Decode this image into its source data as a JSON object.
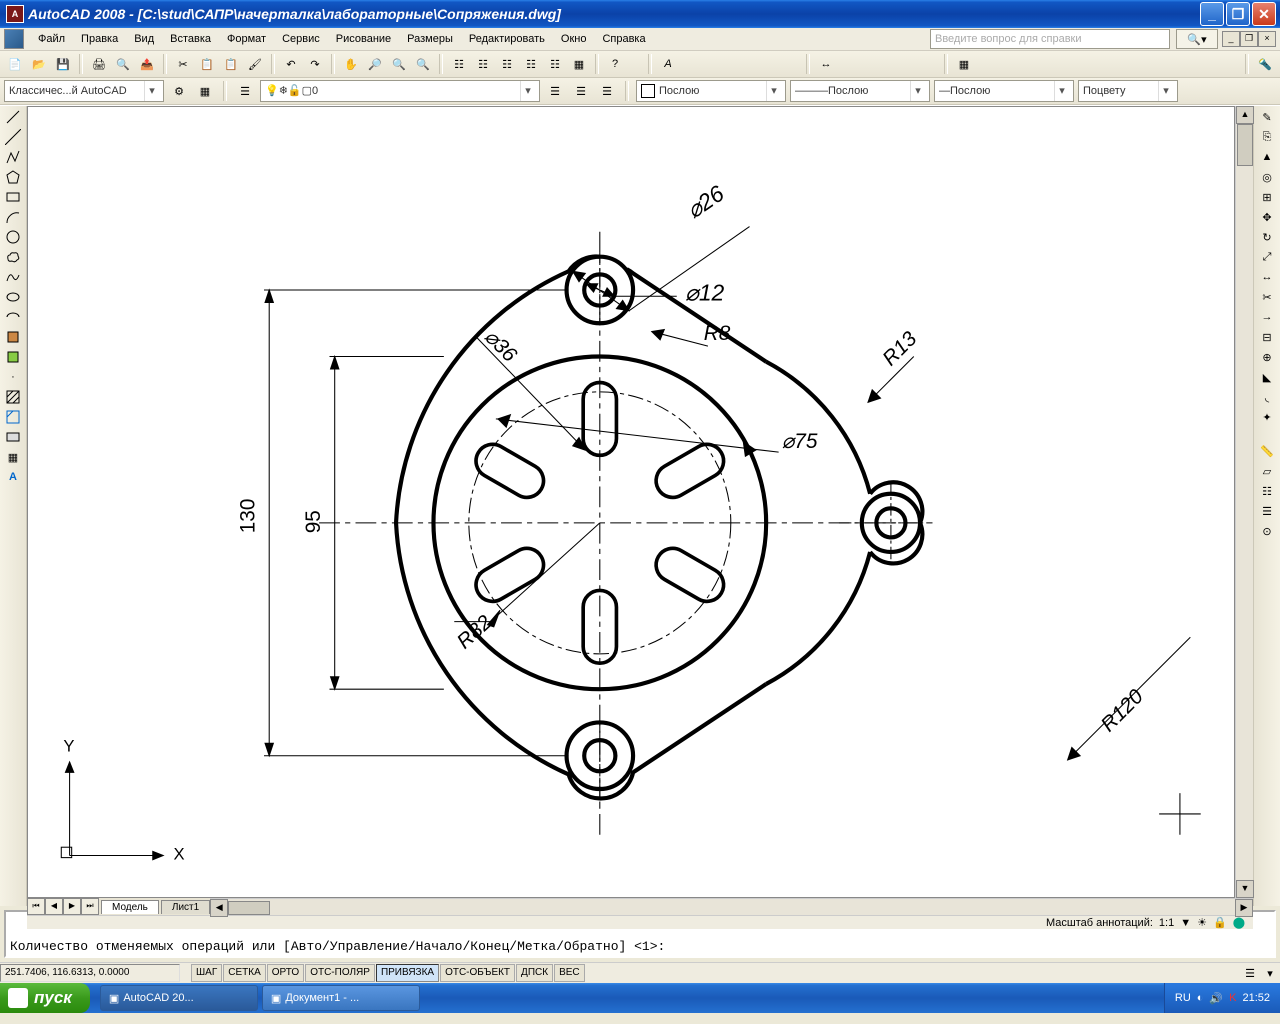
{
  "title": "AutoCAD 2008 - [C:\\stud\\САПР\\начерталка\\лабораторные\\Сопряжения.dwg]",
  "menu": [
    "Файл",
    "Правка",
    "Вид",
    "Вставка",
    "Формат",
    "Сервис",
    "Рисование",
    "Размеры",
    "Редактировать",
    "Окно",
    "Справка"
  ],
  "help_placeholder": "Введите вопрос для справки",
  "workspace_combo": "Классичес...й AutoCAD",
  "layer_combo": "0",
  "bycolor": "Послою",
  "linetype": "Послою",
  "lineweight": "Послою",
  "plotcolor": "Поцвету",
  "tabs": {
    "model": "Модель",
    "sheet1": "Лист1"
  },
  "anno_scale_label": "Масштаб аннотаций:",
  "anno_scale_value": "1:1",
  "cmd_line": "Количество отменяемых операций или [Авто/Управление/Начало/Конец/Метка/Обратно] <1>:",
  "coords": "251.7406, 116.6313, 0.0000",
  "status_buttons": [
    "ШАГ",
    "СЕТКА",
    "ОРТО",
    "ОТС-ПОЛЯР",
    "ПРИВЯЗКА",
    "ОТС-ОБЪЕКТ",
    "ДПСК",
    "ВЕС"
  ],
  "status_active": "ПРИВЯЗКА",
  "start": "пуск",
  "task_items": [
    "AutoCAD 20...",
    "Документ1 - ..."
  ],
  "tray": {
    "lang": "RU",
    "time": "21:52"
  },
  "dims": {
    "d26": "⌀26",
    "d12": "⌀12",
    "d36": "⌀36",
    "d75": "⌀75",
    "r8": "R8",
    "r13": "R13",
    "r82": "R82",
    "r120": "R120",
    "v95": "95",
    "v130": "130"
  },
  "axes": {
    "x": "X",
    "y": "Y"
  }
}
